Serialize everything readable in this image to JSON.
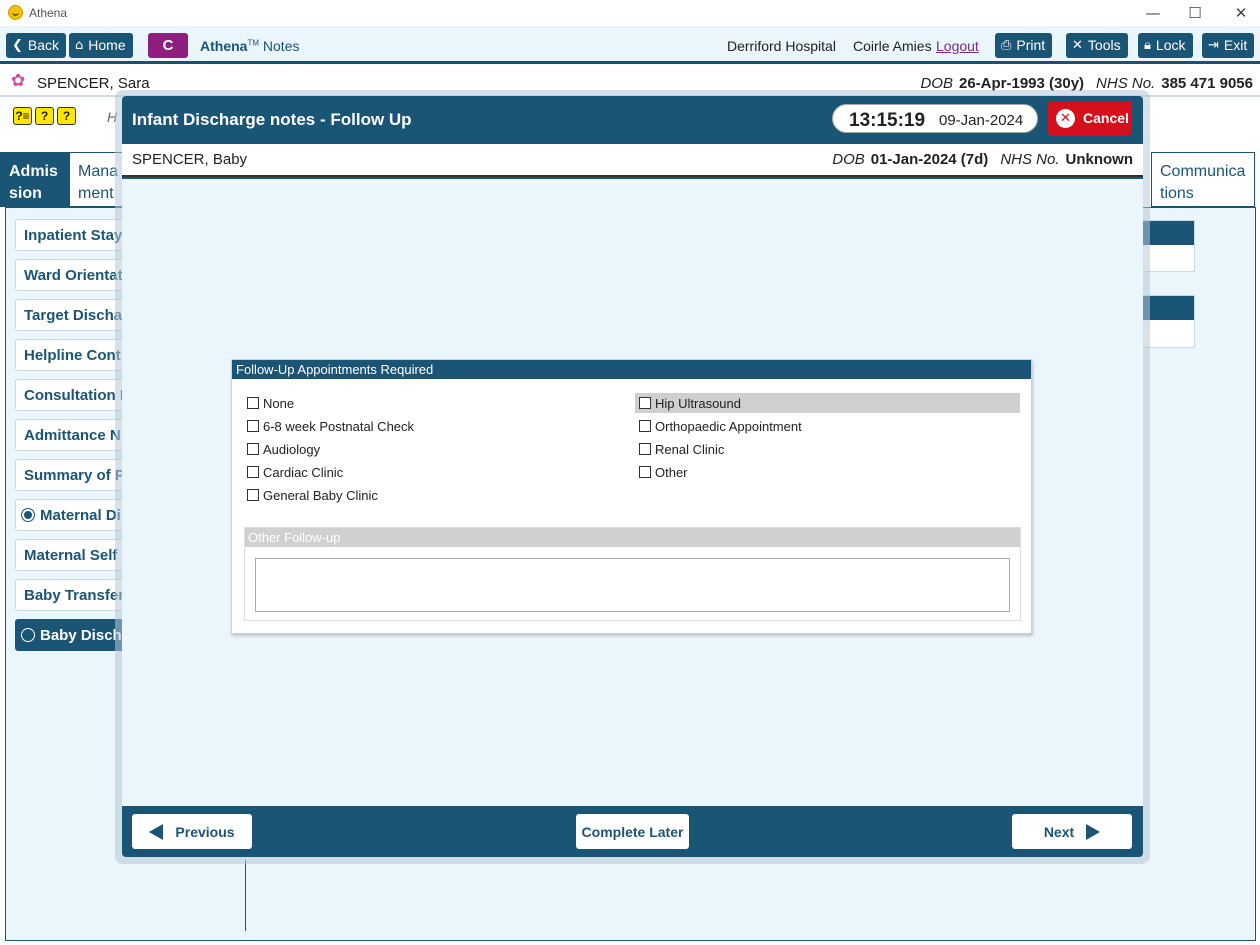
{
  "window": {
    "title": "Athena",
    "controls": {
      "minimize": "—",
      "maximize": "☐",
      "close": "✕"
    }
  },
  "toolbar": {
    "back_label": "Back",
    "home_label": "Home",
    "c_label": "C",
    "brand_name": "Athena",
    "brand_tm": "TM",
    "brand_suffix": "Notes",
    "hospital": "Derriford Hospital",
    "user": "Coirle Amies",
    "logout_label": "Logout",
    "print_label": "Print",
    "tools_label": "Tools",
    "lock_label": "Lock",
    "exit_label": "Exit"
  },
  "patient": {
    "name": "SPENCER, Sara",
    "dob_label": "DOB",
    "dob": "26-Apr-1993 (30y)",
    "nhs_label": "NHS No.",
    "nhs": "385 471 9056"
  },
  "help_icons": [
    "?≡",
    "?",
    "?"
  ],
  "background": {
    "h_letter": "H",
    "tabs": {
      "active": "Admis sion",
      "mana": "Mana ment",
      "comm": "Communica tions"
    },
    "side_items": [
      "Inpatient Stay",
      "Ward Orientat",
      "Target Dischar",
      "Helpline Cont",
      "Consultation I",
      "Admittance N",
      "Summary of P",
      "Maternal Di",
      "Maternal Self",
      "Baby Transfer",
      "Baby Discha"
    ]
  },
  "modal": {
    "title": "Infant Discharge notes - Follow Up",
    "time": "13:15:19",
    "date": "09-Jan-2024",
    "cancel_label": "Cancel",
    "patient": {
      "name": "SPENCER, Baby",
      "dob_label": "DOB",
      "dob": "01-Jan-2024 (7d)",
      "nhs_label": "NHS No.",
      "nhs": "Unknown"
    },
    "panel": {
      "title": "Follow-Up Appointments Required",
      "left_options": [
        "None",
        "6-8 week Postnatal Check",
        "Audiology",
        "Cardiac Clinic",
        "General Baby Clinic"
      ],
      "right_options": [
        "Hip Ultrasound",
        "Orthopaedic Appointment",
        "Renal Clinic",
        "Other"
      ],
      "other_title": "Other Follow-up",
      "other_value": ""
    },
    "footer": {
      "previous_label": "Previous",
      "complete_later_label": "Complete Later",
      "next_label": "Next"
    }
  },
  "colors": {
    "primary": "#1b5576",
    "cancel": "#d6101a",
    "c_button": "#8e1f80",
    "background": "#eaf5fc"
  }
}
